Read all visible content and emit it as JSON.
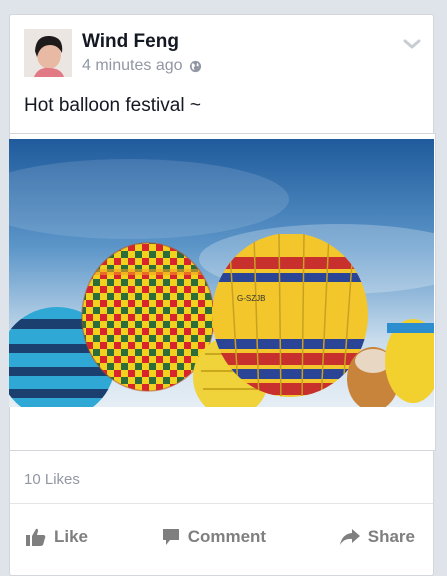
{
  "post": {
    "author": "Wind Feng",
    "timestamp": "4 minutes ago",
    "privacy_icon": "globe-icon",
    "caption": "Hot balloon festival ~",
    "balloon_registration": "G-SZJB"
  },
  "stats": {
    "likes": "10 Likes"
  },
  "actions": {
    "like_label": "Like",
    "comment_label": "Comment",
    "share_label": "Share"
  },
  "colors": {
    "author": "#141823",
    "meta": "#9197a3",
    "action": "#7f7f7f",
    "background": "#dfe3ea"
  }
}
